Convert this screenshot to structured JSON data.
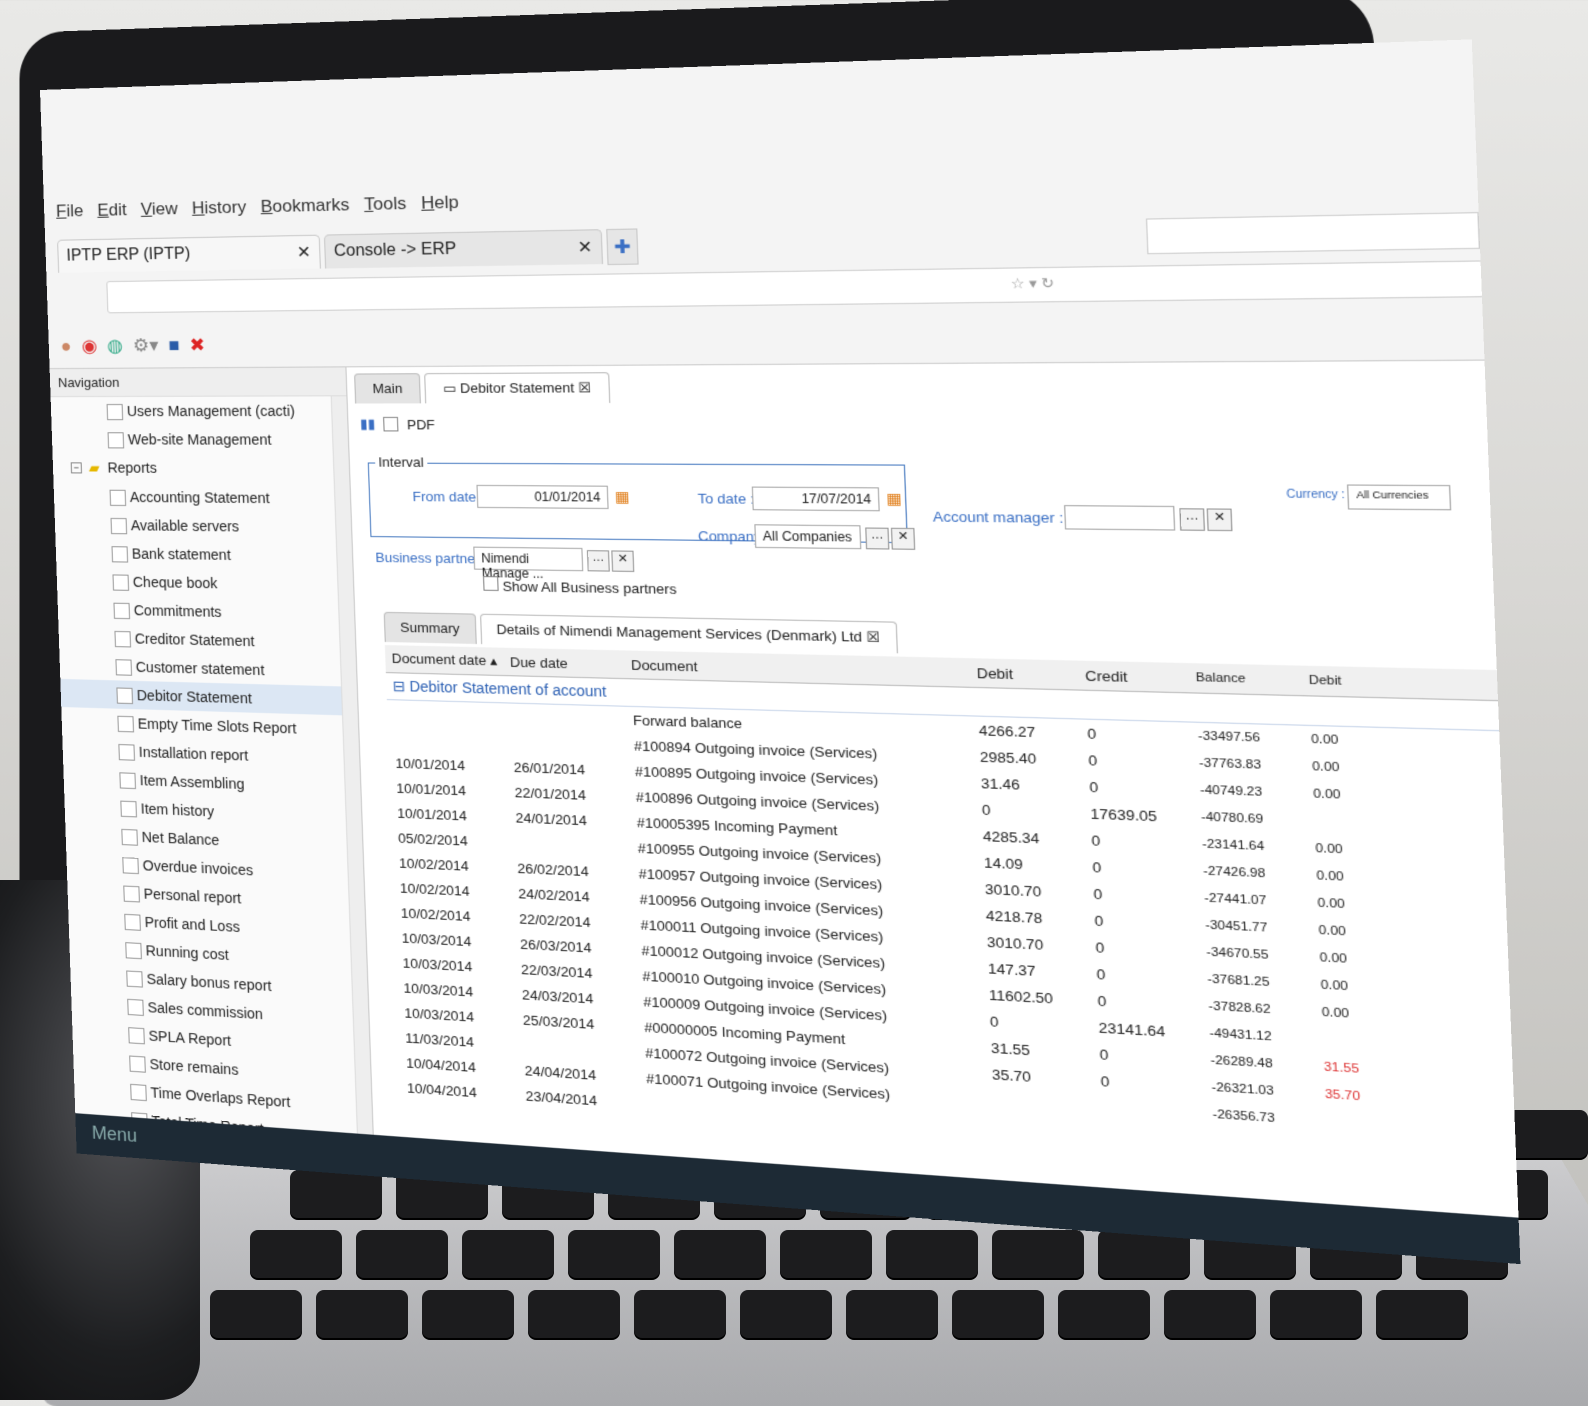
{
  "menu": [
    "File",
    "Edit",
    "View",
    "History",
    "Bookmarks",
    "Tools",
    "Help"
  ],
  "browser_tabs": [
    {
      "label": "IPTP ERP (IPTP)",
      "active": true
    },
    {
      "label": "Console -> ERP",
      "active": false
    }
  ],
  "nav": {
    "title": "Navigation",
    "items_before": [
      "Users Management (cacti)",
      "Web-site Management"
    ],
    "folder": "Reports",
    "items": [
      "Accounting Statement",
      "Available servers",
      "Bank statement",
      "Cheque book",
      "Commitments",
      "Creditor Statement",
      "Customer statement",
      "Debitor Statement",
      "Empty Time Slots Report",
      "Installation report",
      "Item Assembling",
      "Item history",
      "Net Balance",
      "Overdue invoices",
      "Personal report",
      "Profit and Loss",
      "Running cost",
      "Salary bonus report",
      "Sales commission",
      "SPLA Report",
      "Store remains",
      "Time Overlaps Report",
      "Total Time Report"
    ],
    "selected": "Debitor Statement"
  },
  "panel_tabs": [
    "Main",
    "Debitor Statement"
  ],
  "toolbar": {
    "pdf": "PDF"
  },
  "filters": {
    "interval": "Interval",
    "from_label": "From date :",
    "from_value": "01/01/2014",
    "to_label": "To date :",
    "to_value": "17/07/2014",
    "partner_label": "Business partner :",
    "partner_value": "Nimendi Manage ...",
    "company_label": "Company :",
    "company_value": "All Companies",
    "manager_label": "Account manager :",
    "currency_label": "Currency :",
    "currency_value": "All Currencies",
    "show_all": "Show All Business partners"
  },
  "sub_tabs": [
    "Summary",
    "Details of Nimendi Management Services (Denmark) Ltd"
  ],
  "columns": [
    "Document date",
    "Due date",
    "Document",
    "Debit",
    "Credit",
    "Balance",
    "Debit"
  ],
  "group_label": "Debitor Statement of account",
  "rows": [
    {
      "date": "",
      "due": "",
      "doc": "Forward balance",
      "debit": "4266.27",
      "credit": "0",
      "balance": "-33497.56",
      "d2": "0.00"
    },
    {
      "date": "",
      "due": "",
      "doc": "#100894 Outgoing invoice (Services)",
      "debit": "2985.40",
      "credit": "0",
      "balance": "-37763.83",
      "d2": "0.00"
    },
    {
      "date": "10/01/2014",
      "due": "26/01/2014",
      "doc": "#100895 Outgoing invoice (Services)",
      "debit": "31.46",
      "credit": "0",
      "balance": "-40749.23",
      "d2": "0.00"
    },
    {
      "date": "10/01/2014",
      "due": "22/01/2014",
      "doc": "#100896 Outgoing invoice (Services)",
      "debit": "0",
      "credit": "17639.05",
      "balance": "-40780.69",
      "d2": ""
    },
    {
      "date": "10/01/2014",
      "due": "24/01/2014",
      "doc": "#10005395 Incoming Payment",
      "debit": "4285.34",
      "credit": "0",
      "balance": "-23141.64",
      "d2": "0.00"
    },
    {
      "date": "05/02/2014",
      "due": "",
      "doc": "#100955 Outgoing invoice (Services)",
      "debit": "14.09",
      "credit": "0",
      "balance": "-27426.98",
      "d2": "0.00"
    },
    {
      "date": "10/02/2014",
      "due": "26/02/2014",
      "doc": "#100957 Outgoing invoice (Services)",
      "debit": "3010.70",
      "credit": "0",
      "balance": "-27441.07",
      "d2": "0.00"
    },
    {
      "date": "10/02/2014",
      "due": "24/02/2014",
      "doc": "#100956 Outgoing invoice (Services)",
      "debit": "4218.78",
      "credit": "0",
      "balance": "-30451.77",
      "d2": "0.00"
    },
    {
      "date": "10/02/2014",
      "due": "22/02/2014",
      "doc": "#100011 Outgoing invoice (Services)",
      "debit": "3010.70",
      "credit": "0",
      "balance": "-34670.55",
      "d2": "0.00"
    },
    {
      "date": "10/03/2014",
      "due": "26/03/2014",
      "doc": "#100012 Outgoing invoice (Services)",
      "debit": "147.37",
      "credit": "0",
      "balance": "-37681.25",
      "d2": "0.00"
    },
    {
      "date": "10/03/2014",
      "due": "22/03/2014",
      "doc": "#100010 Outgoing invoice (Services)",
      "debit": "11602.50",
      "credit": "0",
      "balance": "-37828.62",
      "d2": "0.00"
    },
    {
      "date": "10/03/2014",
      "due": "24/03/2014",
      "doc": "#100009 Outgoing invoice (Services)",
      "debit": "0",
      "credit": "23141.64",
      "balance": "-49431.12",
      "d2": ""
    },
    {
      "date": "10/03/2014",
      "due": "25/03/2014",
      "doc": "#00000005 Incoming Payment",
      "debit": "31.55",
      "credit": "0",
      "balance": "-26289.48",
      "d2": "31.55"
    },
    {
      "date": "11/03/2014",
      "due": "",
      "doc": "#100072 Outgoing invoice (Services)",
      "debit": "35.70",
      "credit": "0",
      "balance": "-26321.03",
      "d2": "35.70"
    },
    {
      "date": "10/04/2014",
      "due": "24/04/2014",
      "doc": "#100071 Outgoing invoice (Services)",
      "debit": "",
      "credit": "",
      "balance": "-26356.73",
      "d2": ""
    },
    {
      "date": "10/04/2014",
      "due": "23/04/2014",
      "doc": "",
      "debit": "",
      "credit": "",
      "balance": "",
      "d2": ""
    }
  ],
  "taskbar": "Menu"
}
